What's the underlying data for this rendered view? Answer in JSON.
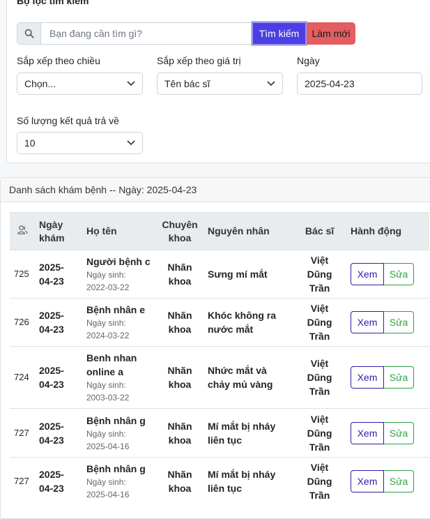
{
  "filter": {
    "title": "Bộ lọc tìm kiếm",
    "search_placeholder": "Bạn đang cần tìm gì?",
    "search_button": "Tìm kiếm",
    "reset_button": "Làm mới",
    "sort_dir_label": "Sắp xếp theo chiều",
    "sort_dir_value": "Chọn...",
    "sort_val_label": "Sắp xếp theo giá trị",
    "sort_val_value": "Tên bác sĩ",
    "date_label": "Ngày",
    "date_value": "2025-04-23",
    "count_label": "Số lượng kết quả trả về",
    "count_value": "10"
  },
  "list": {
    "header": "Danh sách khám bệnh -- Ngày: 2025-04-23",
    "columns": [
      "Ngày khám",
      "Họ tên",
      "Chuyên khoa",
      "Nguyên nhân",
      "Bác sĩ",
      "Hành động"
    ],
    "dob_label": "Ngày sinh:",
    "view_label": "Xem",
    "edit_label": "Sửa",
    "rows": [
      {
        "id": "725",
        "date": "2025-04-23",
        "name": "Người bệnh c",
        "dob": "2022-03-22",
        "specialty": "Nhãn khoa",
        "reason": "Sưng mí mắt",
        "doctor": "Việt Dũng Trần"
      },
      {
        "id": "726",
        "date": "2025-04-23",
        "name": "Bệnh nhân e",
        "dob": "2024-03-22",
        "specialty": "Nhãn khoa",
        "reason": "Khóc không ra nước mắt",
        "doctor": "Việt Dũng Trần"
      },
      {
        "id": "724",
        "date": "2025-04-23",
        "name": "Benh nhan online a",
        "dob": "2003-03-22",
        "specialty": "Nhãn khoa",
        "reason": "Nhức mắt và chảy mủ vàng",
        "doctor": "Việt Dũng Trần"
      },
      {
        "id": "727",
        "date": "2025-04-23",
        "name": "Bệnh nhân g",
        "dob": "2025-04-16",
        "specialty": "Nhãn khoa",
        "reason": "Mí mắt bị nháy liên tục",
        "doctor": "Việt Dũng Trần"
      },
      {
        "id": "727",
        "date": "2025-04-23",
        "name": "Bệnh nhân g",
        "dob": "2025-04-16",
        "specialty": "Nhãn khoa",
        "reason": "Mí mắt bị nháy liên tục",
        "doctor": "Việt Dũng Trần"
      }
    ]
  }
}
